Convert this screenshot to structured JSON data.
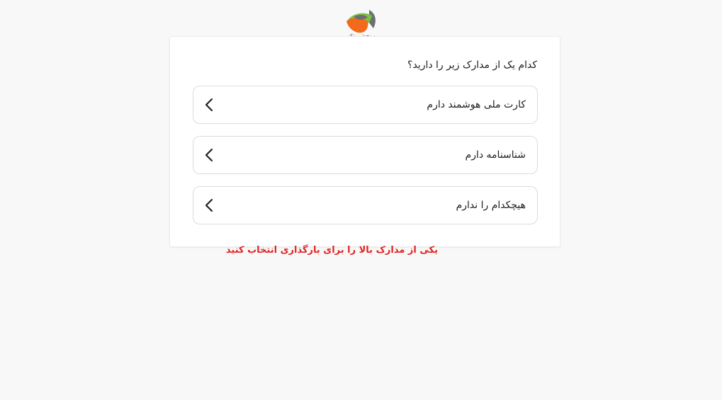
{
  "logo": {
    "icon": "brand-logo-icon",
    "caption": "سنجش یوتکو"
  },
  "form": {
    "question": "کدام یک از مدارک زیر را دارید؟",
    "options": [
      {
        "label": "کارت ملی هوشمند دارم",
        "icon": "chevron-left-icon"
      },
      {
        "label": "شناسنامه دارم",
        "icon": "chevron-left-icon"
      },
      {
        "label": "هیچکدام را ندارم",
        "icon": "chevron-left-icon"
      }
    ]
  },
  "error_message": "یکی از مدارک بالا را برای بارگذاری انتخاب کنید",
  "colors": {
    "error": "#e02424",
    "logo_orange": "#f26a1b",
    "logo_green": "#7cc242",
    "logo_gray": "#6d6e71"
  }
}
